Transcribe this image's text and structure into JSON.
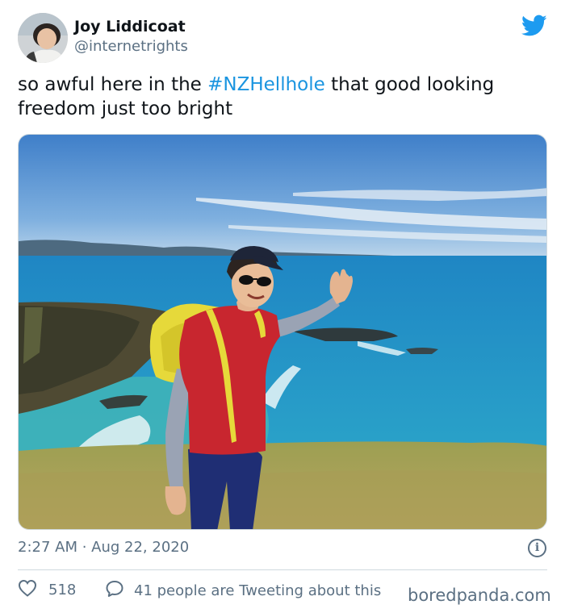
{
  "author": {
    "name": "Joy Liddicoat",
    "handle": "@internetrights"
  },
  "tweet": {
    "text_before": "so awful here in the ",
    "hashtag": "#NZHellhole",
    "text_after": " that good looking freedom just too bright"
  },
  "meta": {
    "timestamp": "2:27 AM · Aug 22, 2020",
    "info_glyph": "i"
  },
  "actions": {
    "likes": "518",
    "conversation": "41 people are Tweeting about this"
  },
  "watermark": "boredpanda.com",
  "colors": {
    "twitter_blue": "#1d9bf0",
    "hashtag": "#1b95e0",
    "muted": "#5b7083"
  },
  "icons": [
    "twitter-bird-icon",
    "info-icon",
    "heart-icon",
    "speech-bubble-icon"
  ]
}
